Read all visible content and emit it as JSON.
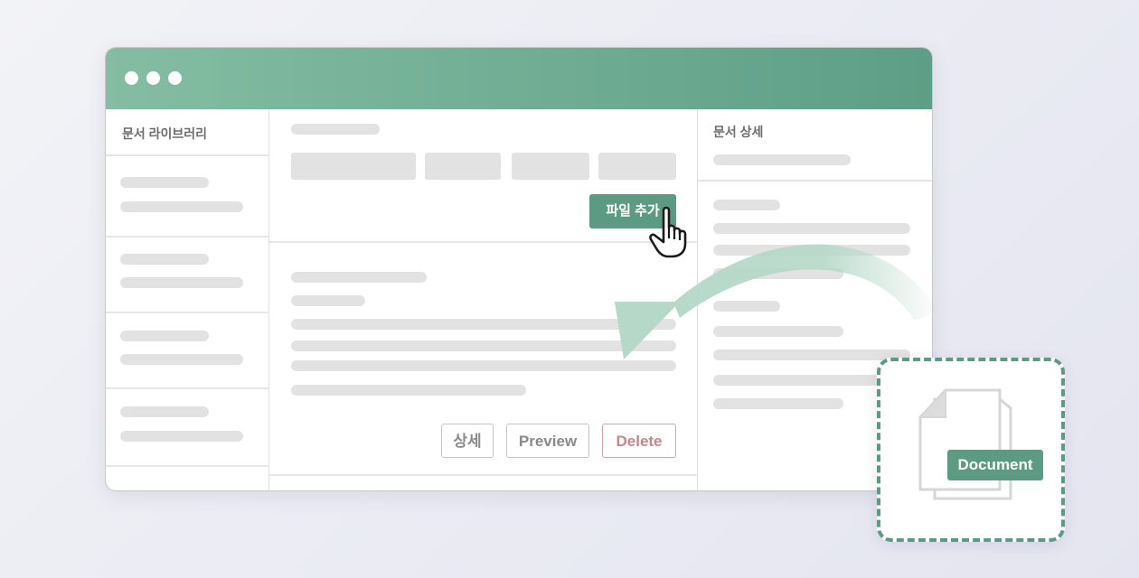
{
  "sidebar": {
    "title": "문서 라이브러리"
  },
  "main": {
    "add_file_label": "파일 추가",
    "actions": {
      "details_label": "상세",
      "preview_label": "Preview",
      "delete_label": "Delete"
    }
  },
  "detail": {
    "title": "문서 상세"
  },
  "drop_zone": {
    "file_label": "Document"
  },
  "colors": {
    "accent": "#5c9a84",
    "titlebar_start": "#84bda2",
    "titlebar_end": "#5e9e87",
    "delete": "#c98586",
    "arrow": "#b5d8c8"
  },
  "icons": {
    "cursor": "hand-pointer-icon",
    "document": "document-icon"
  }
}
